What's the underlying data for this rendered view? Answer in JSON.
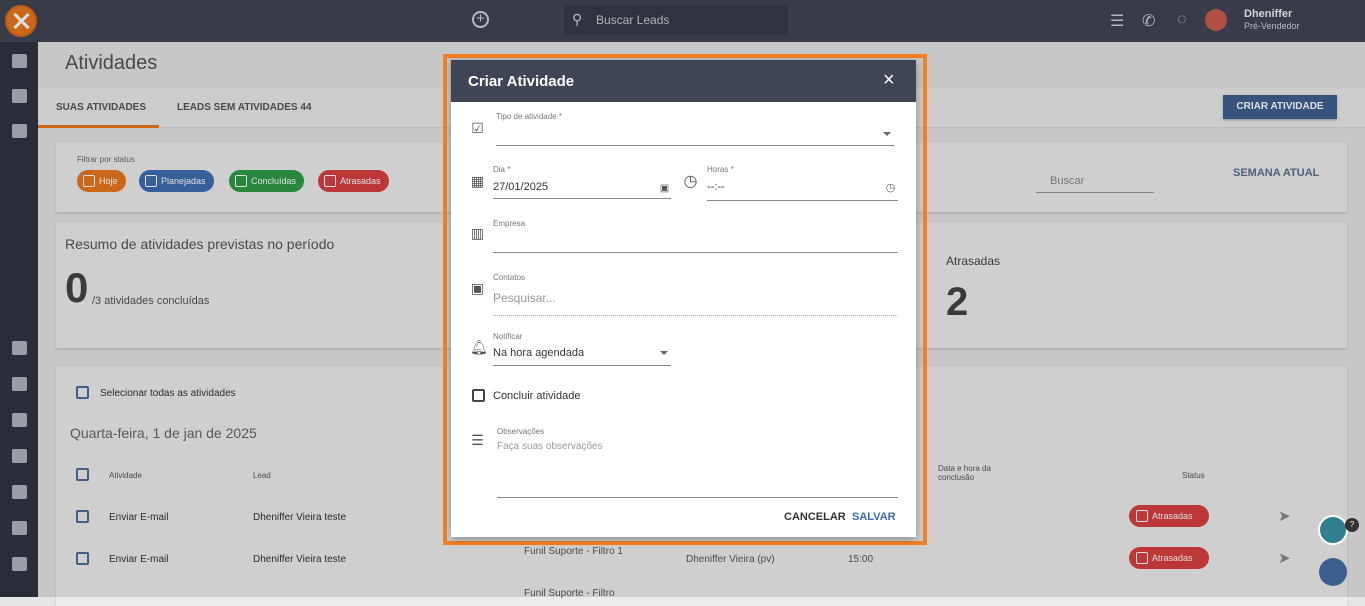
{
  "topbar": {
    "search_placeholder": "Buscar Leads",
    "user_name": "Dheniffer",
    "user_role": "Pré-Vendedor"
  },
  "page": {
    "title": "Atividades"
  },
  "tabs": [
    {
      "label": "SUAS ATIVIDADES"
    },
    {
      "label": "LEADS SEM ATIVIDADES 44"
    }
  ],
  "create_button": "CRIAR ATIVIDADE",
  "filters": {
    "label": "Filtrar por status",
    "chips": [
      {
        "label": "Hoje",
        "color": "#e8761e"
      },
      {
        "label": "Planejadas",
        "color": "#3d6bb0"
      },
      {
        "label": "Concluídas",
        "color": "#2e9a45"
      },
      {
        "label": "Atrasadas",
        "color": "#d64040"
      }
    ],
    "search_placeholder": "Buscar",
    "week_button": "SEMANA ATUAL"
  },
  "summary": {
    "title": "Resumo de atividades previstas no período",
    "done": "0",
    "total_text": "/3 atividades concluídas",
    "late_label": "Atrasadas",
    "late_count": "2"
  },
  "list": {
    "select_all": "Selecionar todas as atividades",
    "date_heading": "Quarta-feira, 1 de jan de 2025",
    "headers": {
      "activity": "Atividade",
      "lead": "Lead",
      "conclusion": "Data e hora da conclusão",
      "status": "Status"
    },
    "rows": [
      {
        "activity": "Enviar E-mail",
        "lead": "Dheniffer Vieira teste",
        "funnel": "",
        "owner": "",
        "time": "",
        "status": "Atrasadas"
      },
      {
        "activity": "Enviar E-mail",
        "lead": "Dheniffer Vieira teste",
        "funnel": "Funil Suporte - Filtro 1",
        "owner": "Dheniffer Vieira (pv)",
        "time": "15:00",
        "status": "Atrasadas"
      },
      {
        "funnel": "Funil Suporte - Filtro"
      }
    ]
  },
  "modal": {
    "title": "Criar Atividade",
    "close": "×",
    "type_label": "Tipo de atividade *",
    "day_label": "Dia *",
    "day_value": "27/01/2025",
    "hour_label": "Horas *",
    "hour_value": "--:--",
    "company_label": "Empresa",
    "contacts_label": "Contatos",
    "contacts_placeholder": "Pesquisar...",
    "notify_label": "Notificar",
    "notify_value": "Na hora agendada",
    "complete_label": "Concluir atividade",
    "notes_label": "Observações",
    "notes_placeholder": "Faça suas observações",
    "cancel": "CANCELAR",
    "save": "SALVAR"
  },
  "widgets": {
    "badge": "?"
  }
}
